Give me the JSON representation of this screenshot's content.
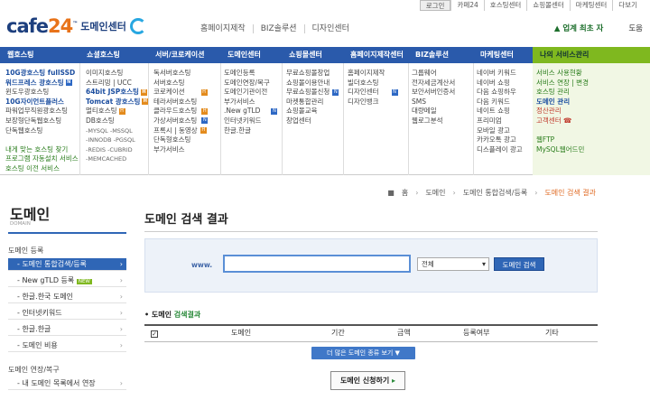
{
  "util_links": [
    "로그인",
    "카페24",
    "호스팅센터",
    "쇼핑몰센터",
    "마케팅센터",
    "다보기"
  ],
  "logo": {
    "brand_a": "cafe",
    "brand_b": "24",
    "tm": "™",
    "sub": "도메인센터"
  },
  "top_nav": [
    "홈페이지제작",
    "BIZ솔루션",
    "디자인센터"
  ],
  "header_right": {
    "biz": "업계 최초 자",
    "help": "도움"
  },
  "mega_menu": {
    "headers": [
      "웹호스팅",
      "쇼셜호스팅",
      "서버/코로케이션",
      "도메인센터",
      "쇼핑몰센터",
      "홈페이지제작센터",
      "BIZ솔루션",
      "마케팅센터",
      "나의 서비스관리"
    ],
    "columns": [
      [
        "10G광호스팅 fullSSD",
        "워드프레스 광호스팅",
        "윈도우광호스팅",
        "10G자이언트플러스",
        "파워업무직원광호스팅",
        "보장형단독웹호스팅",
        "단독웹호스팅",
        "",
        "내게 맞는 호스팅 찾기",
        "프로그램 자동설치 서비스",
        "호스팅 이전 서비스"
      ],
      [
        "이미지호스팅",
        "스트리밍 | UCC",
        "64bit JSP호스팅",
        "Tomcat 광호스팅",
        "멀티호스팅",
        "DB호스팅",
        "-MYSQL -MSSQL",
        "-INNODB -PGSQL",
        "-REDIS -CUBRID",
        "-MEMCACHED"
      ],
      [
        "독서버호스팅",
        "서버호스팅",
        "코로케이션",
        "테라서버호스팅",
        "클라우드호스팅",
        "가상서버호스팅",
        "프록시 | 동영상",
        "단독형호스팅",
        "부가서비스"
      ],
      [
        "도메인등록",
        "도메인연장/복구",
        "도메인기관이전",
        "부가서비스",
        ".New gTLD",
        "인터넷키워드",
        "한글.한글"
      ],
      [
        "무료쇼핑몰창업",
        "쇼핑몰이용안내",
        "무료쇼핑몰신청",
        "마켓통합관리",
        "쇼핑몰교육",
        "창업센터"
      ],
      [
        "홈페이지제작",
        "빌더호스팅",
        "디자인센터",
        "디자인뱅크"
      ],
      [
        "그룹웨어",
        "전자세금계산서",
        "보안서버인증서",
        "SMS",
        "대량메일",
        "웹로그분석"
      ],
      [
        "네이버 키워드",
        "네이버 쇼핑",
        "다음 쇼핑하우",
        "다음 키워드",
        "네이트 쇼핑",
        "프리미엄",
        "모바일 광고",
        "카카오톡 광고",
        "디스플레이 광고"
      ],
      [
        "서비스 사용현황",
        "서비스 연장 | 변경",
        "호스팅 관리",
        "도메인 관리",
        "정산관리",
        "고객센터 ☎",
        "",
        "웹FTP",
        "MySQL웹어드민"
      ]
    ]
  },
  "sidebar": {
    "title": "도메인",
    "subtitle": "DOMAIN",
    "cat1": "도메인 등록",
    "items1": [
      "도메인 통합검색/등록",
      "New gTLD 등록",
      "한글.한국 도메인",
      "인터넷키워드",
      "한글.한글",
      "도메인 비용"
    ],
    "new_badge": "NEW",
    "cat2": "도메인 연장/복구",
    "items2": [
      "내 도메인 목록에서 연장"
    ]
  },
  "breadcrumb": {
    "home": "홈",
    "domain": "도메인",
    "mid": "도메인 통합검색/등록",
    "current": "도메인 검색 결과"
  },
  "page_title": "도메인 검색 결과",
  "search": {
    "www": "www.",
    "value": "",
    "select_value": "전체",
    "button": "도메인 검색"
  },
  "results": {
    "title_a": "도메인 ",
    "title_b": "검색결과",
    "columns": [
      "도메인",
      "기간",
      "금액",
      "등록여부",
      "기타"
    ]
  },
  "more_button": "더 많은 도메인 종류 보기 ▼",
  "apply_button": "도메인 신청하기",
  "colors": {
    "nav_blue": "#2a5aab",
    "accent_orange": "#e06b24",
    "my_green": "#7fb81f"
  }
}
